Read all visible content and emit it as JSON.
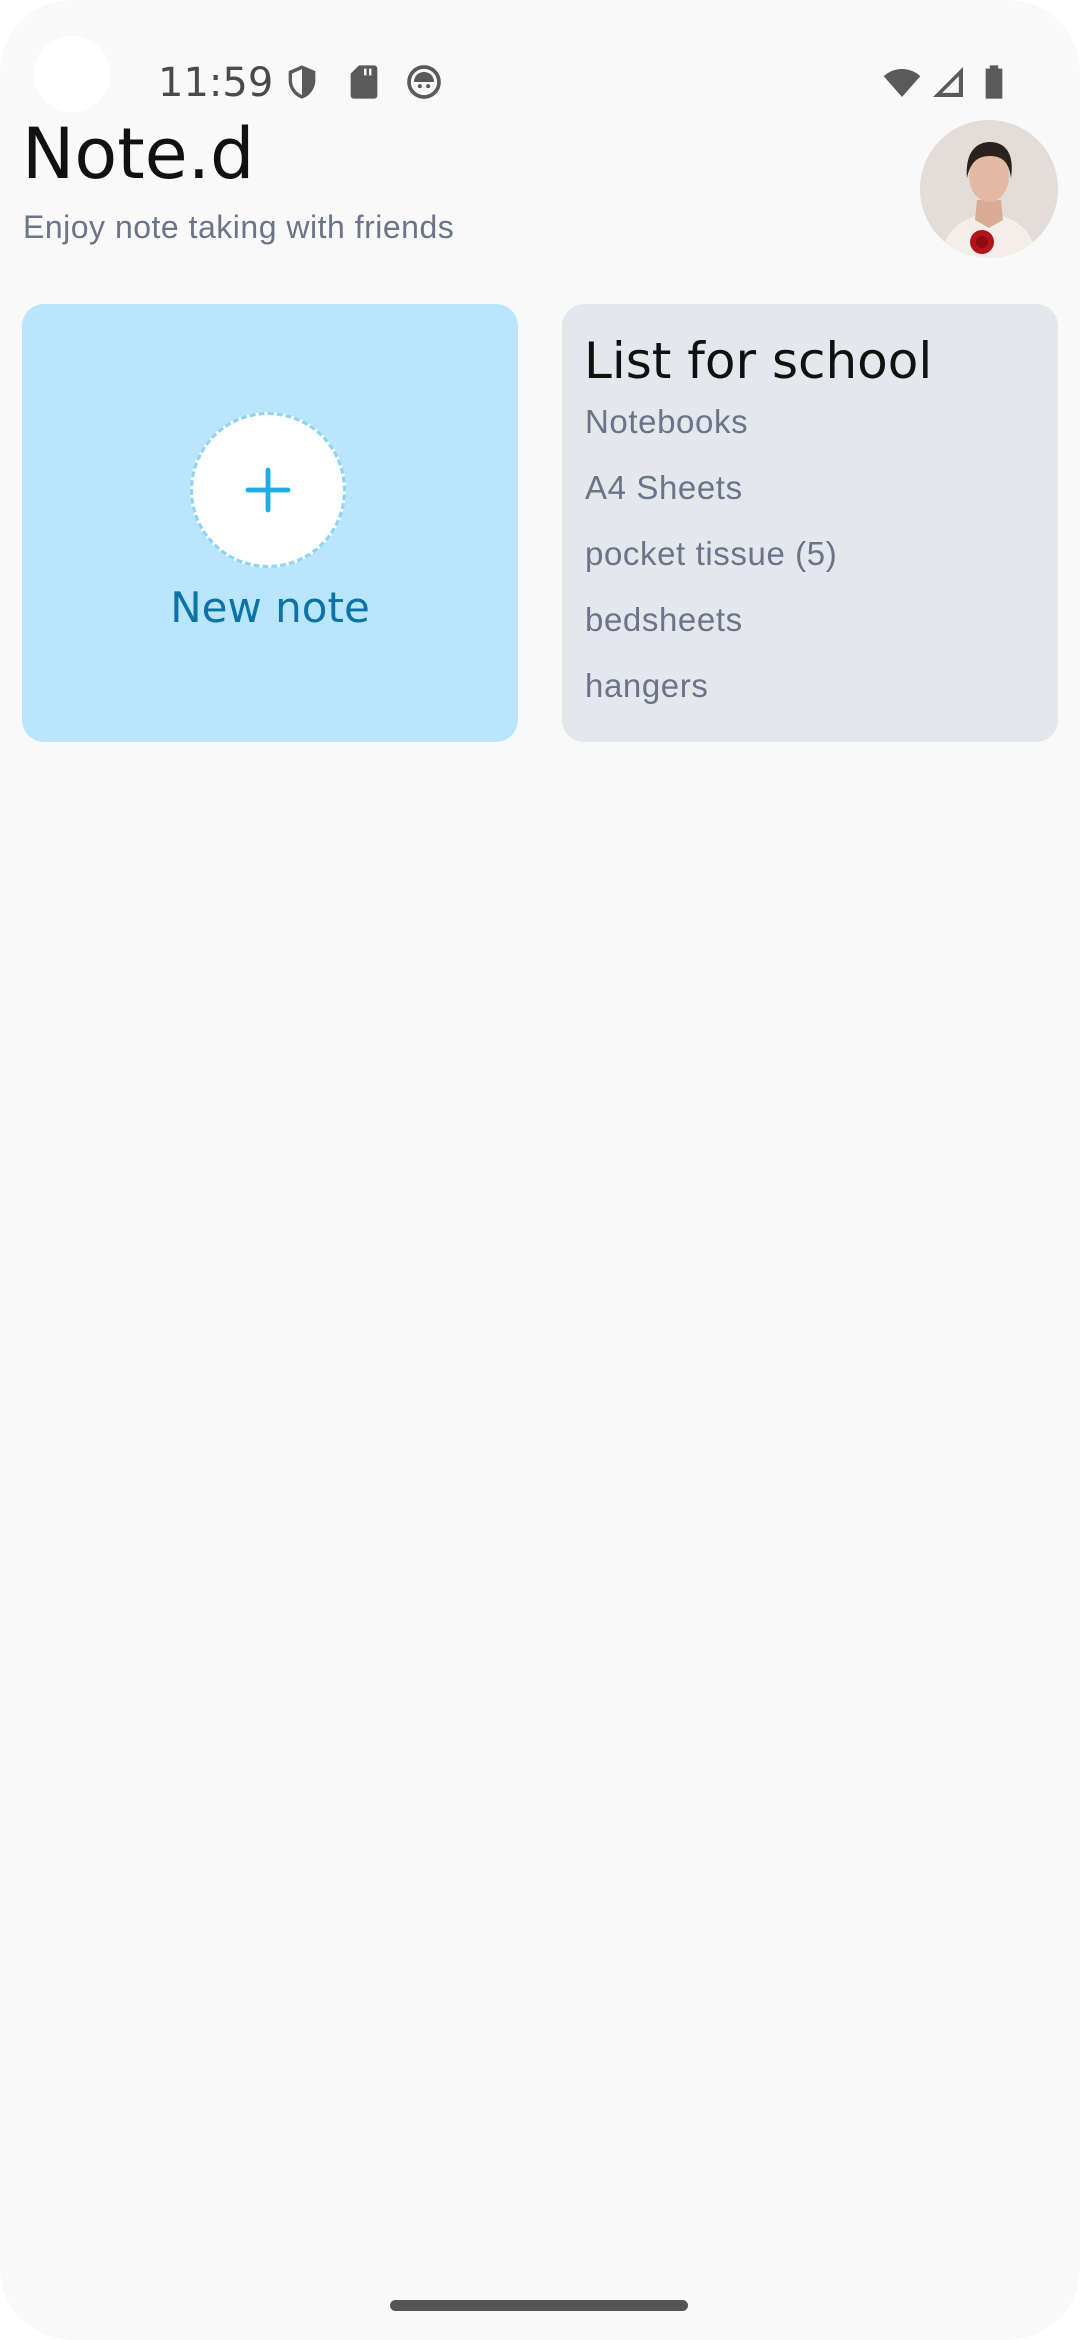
{
  "status_bar": {
    "time": "11:59",
    "left_icons": [
      "shield-icon",
      "sd-card-icon",
      "android-icon"
    ],
    "right_icons": [
      "wifi-icon",
      "cell-signal-icon",
      "battery-icon"
    ]
  },
  "header": {
    "title": "Note.d",
    "subtitle": "Enjoy note taking with friends",
    "avatar_icon": "user-avatar"
  },
  "new_note_card": {
    "label": "New note",
    "icon": "plus-icon",
    "background_color": "#bae6fd",
    "accent_color": "#0c72a8"
  },
  "notes": [
    {
      "title": "List for school",
      "items": [
        "Notebooks",
        "A4 Sheets",
        "pocket tissue (5)",
        "bedsheets",
        "hangers"
      ],
      "background_color": "#e4e7ec"
    }
  ]
}
